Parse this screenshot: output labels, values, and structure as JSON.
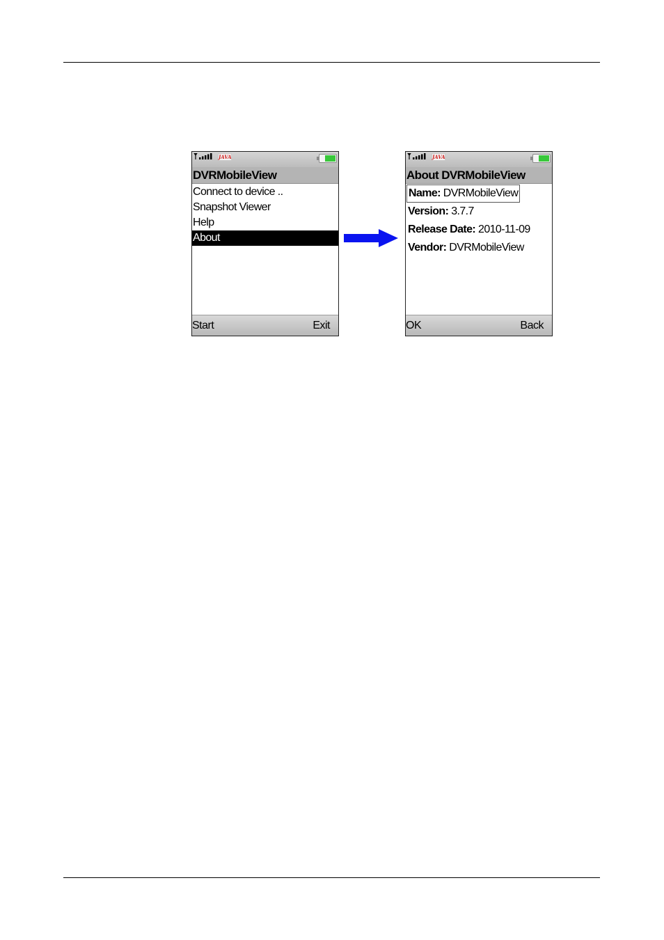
{
  "colors": {
    "arrow": "#0a14f0",
    "titlebar": "#b4b4b4",
    "selection": "#000000",
    "battery": "#38c83a",
    "java_badge_text": "#d0201f"
  },
  "icons": {
    "signal": "signal-strength-icon",
    "app_badge": "java-icon",
    "battery": "battery-icon",
    "transition": "right-arrow-icon"
  },
  "left_screen": {
    "status": {
      "app_badge": "JAVA"
    },
    "title": "DVRMobileView",
    "menu_items": [
      {
        "label": "Connect to device ..",
        "selected": false
      },
      {
        "label": "Snapshot Viewer",
        "selected": false
      },
      {
        "label": "Help",
        "selected": false
      },
      {
        "label": "About",
        "selected": true
      }
    ],
    "softkeys": {
      "left": "Start",
      "right": "Exit"
    }
  },
  "right_screen": {
    "status": {
      "app_badge": "JAVA"
    },
    "title": "About DVRMobileView",
    "fields": [
      {
        "label": "Name:",
        "value": "DVRMobileView",
        "focused": true
      },
      {
        "label": "Version:",
        "value": "3.7.7",
        "focused": false
      },
      {
        "label": "Release Date:",
        "value": "2010-11-09",
        "focused": false
      },
      {
        "label": "Vendor:",
        "value": "DVRMobileView",
        "focused": false
      }
    ],
    "softkeys": {
      "left": "OK",
      "right": "Back"
    }
  }
}
